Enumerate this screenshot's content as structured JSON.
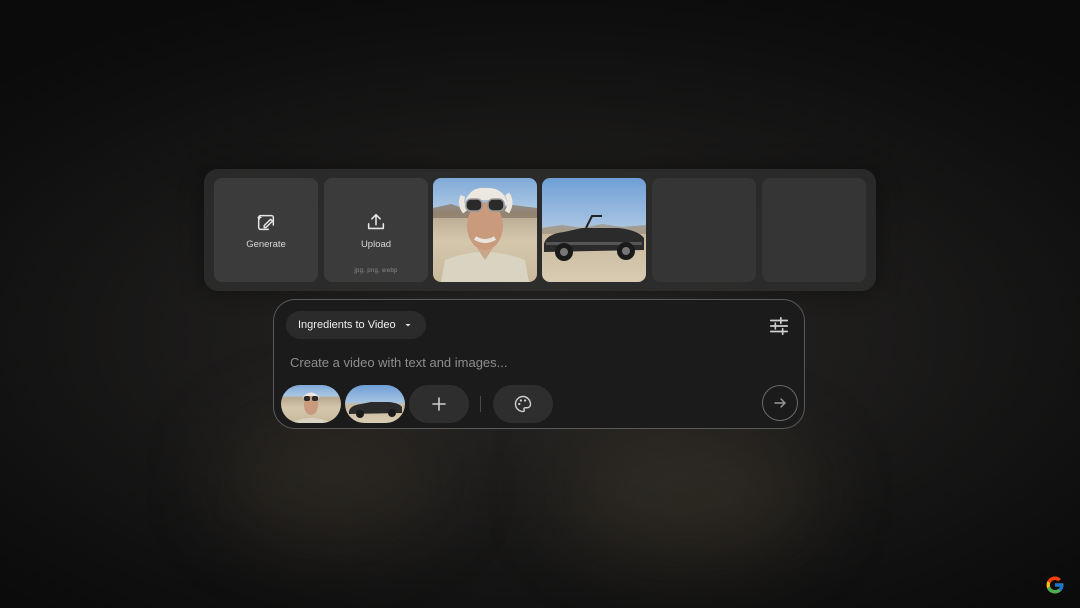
{
  "tray": {
    "generate_label": "Generate",
    "upload_label": "Upload",
    "upload_hint": "jpg, png, webp"
  },
  "prompt_panel": {
    "mode_label": "Ingredients to Video",
    "placeholder": "Create a video with text and images..."
  },
  "icons": {
    "generate": "sparkle-edit-icon",
    "upload": "upload-icon",
    "mode_caret": "caret-down-icon",
    "settings": "sliders-icon",
    "add": "plus-icon",
    "style": "palette-icon",
    "send": "arrow-right-icon",
    "brand": "google-g-logo"
  },
  "colors": {
    "panel_border": "#5a5a5a",
    "tray_bg": "#303030",
    "placeholder": "#8e8e8e"
  }
}
